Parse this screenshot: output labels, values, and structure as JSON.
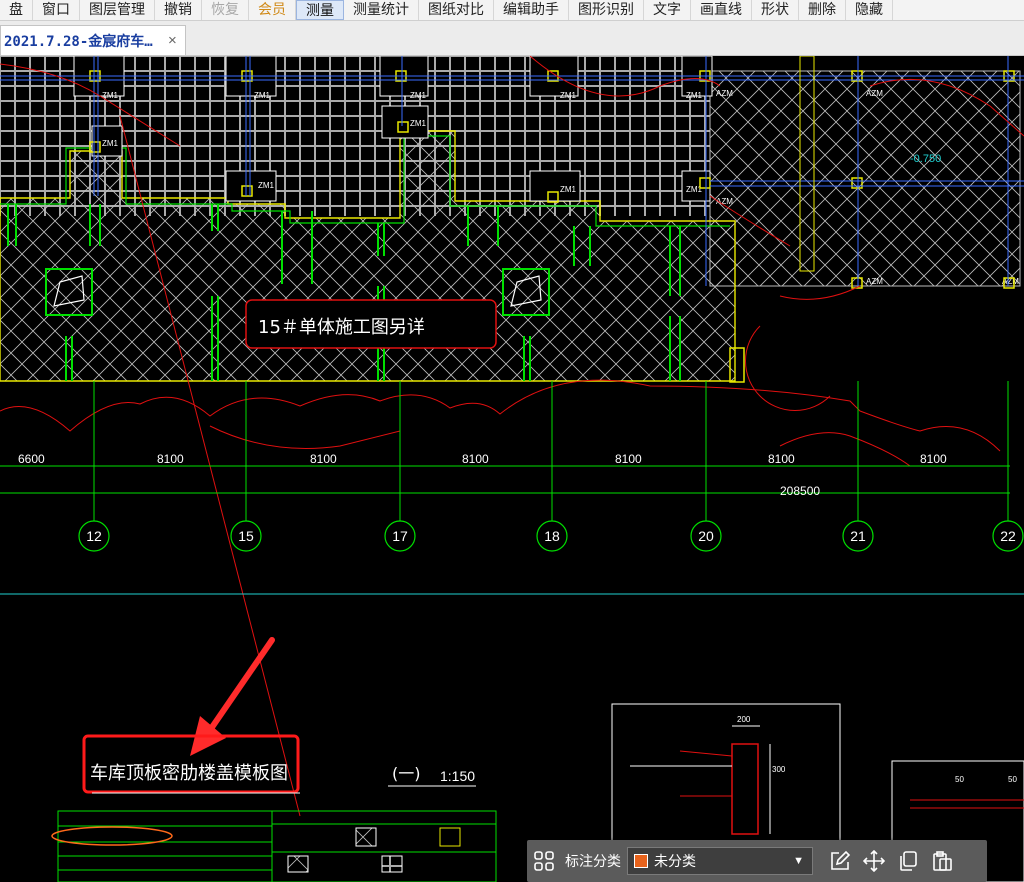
{
  "menu": {
    "items": [
      {
        "label": "盘",
        "state": "normal"
      },
      {
        "label": "窗口",
        "state": "normal"
      },
      {
        "label": "图层管理",
        "state": "normal"
      },
      {
        "label": "撤销",
        "state": "normal"
      },
      {
        "label": "恢复",
        "state": "disabled"
      },
      {
        "label": "会员",
        "state": "vip"
      },
      {
        "label": "测量",
        "state": "active"
      },
      {
        "label": "测量统计",
        "state": "normal"
      },
      {
        "label": "图纸对比",
        "state": "normal"
      },
      {
        "label": "编辑助手",
        "state": "normal"
      },
      {
        "label": "图形识别",
        "state": "normal"
      },
      {
        "label": "文字",
        "state": "normal"
      },
      {
        "label": "画直线",
        "state": "normal"
      },
      {
        "label": "形状",
        "state": "normal"
      },
      {
        "label": "删除",
        "state": "normal"
      },
      {
        "label": "隐藏",
        "state": "normal"
      }
    ]
  },
  "tab": {
    "title": "2021.7.28-金宸府车…",
    "close_glyph": "×"
  },
  "drawing": {
    "note_box_text": "15＃单体施工图另详",
    "title": "车库顶板密肋楼盖模板图",
    "title_index": "(一)",
    "scale": "1:150",
    "level_label": "-0.750",
    "total_dimension": "208500",
    "spans": [
      "6600",
      "8100",
      "8100",
      "8100",
      "8100",
      "8100",
      "8100"
    ],
    "axes": [
      "12",
      "15",
      "17",
      "18",
      "20",
      "21",
      "22"
    ],
    "col_tag": "ZM1",
    "col_tag_b": "AZM",
    "detail_dims": [
      "200",
      "300",
      "50",
      "50"
    ],
    "colors": {
      "green": "#00e000",
      "red": "#e01010",
      "gray": "#bdbdbd",
      "yellow": "#e8e800",
      "cyan": "#20d0d0",
      "accent_box": "#ff1a1a",
      "swatch": "#e8631c"
    }
  },
  "bottom_toolbar": {
    "category_label": "标注分类",
    "category_value": "未分类",
    "icons": [
      "grid-icon",
      "edit-icon",
      "move-icon",
      "copy-icon",
      "paste-icon"
    ]
  }
}
